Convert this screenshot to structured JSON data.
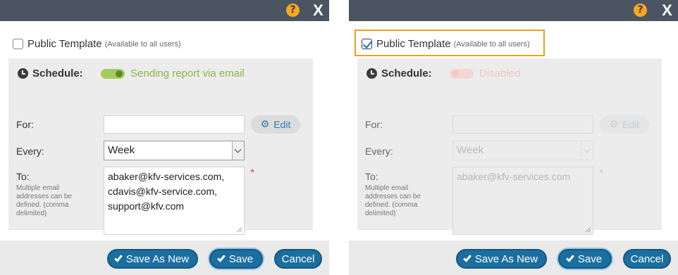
{
  "left_dialog": {
    "help_icon": "?",
    "close_label": "X",
    "public_template": {
      "label": "Public Template",
      "note": "(Available to all users)",
      "checked": false
    },
    "schedule": {
      "label": "Schedule:",
      "toggle_state": "on",
      "toggle_text": "Sending report via email",
      "for_label": "For:",
      "for_value": "",
      "edit_label": "Edit",
      "every_label": "Every:",
      "every_value": "Week",
      "to_label": "To:",
      "to_hint": "Multiple email addresses can be defined. (comma delimited)",
      "to_line1": "abaker@kfv-services.com,",
      "to_line2": "cdavis@kfv-service.com,",
      "to_line3": "support@kfv.com",
      "required_mark": "*"
    },
    "buttons": {
      "save_as_new": "Save As New",
      "save": "Save",
      "cancel": "Cancel"
    }
  },
  "right_dialog": {
    "help_icon": "?",
    "close_label": "X",
    "public_template": {
      "label": "Public Template",
      "note": "(Available to all users)",
      "checked": true
    },
    "schedule": {
      "label": "Schedule:",
      "toggle_state": "off",
      "toggle_text": "Disabled",
      "for_label": "For:",
      "for_value": "",
      "edit_label": "Edit",
      "every_label": "Every:",
      "every_value": "Week",
      "to_label": "To:",
      "to_hint": "Multiple email addresses can be defined. (comma delimited)",
      "to_line1": "abaker@kfv-services.com",
      "required_mark": "*"
    },
    "buttons": {
      "save_as_new": "Save As New",
      "save": "Save",
      "cancel": "Cancel"
    }
  },
  "colors": {
    "titlebar": "#4a5561",
    "accent_blue": "#1b6fa0",
    "toggle_on": "#a4cc5a",
    "toggle_off": "#f3d6d6",
    "highlight": "#e8a21b",
    "help_icon": "#f5a623"
  }
}
